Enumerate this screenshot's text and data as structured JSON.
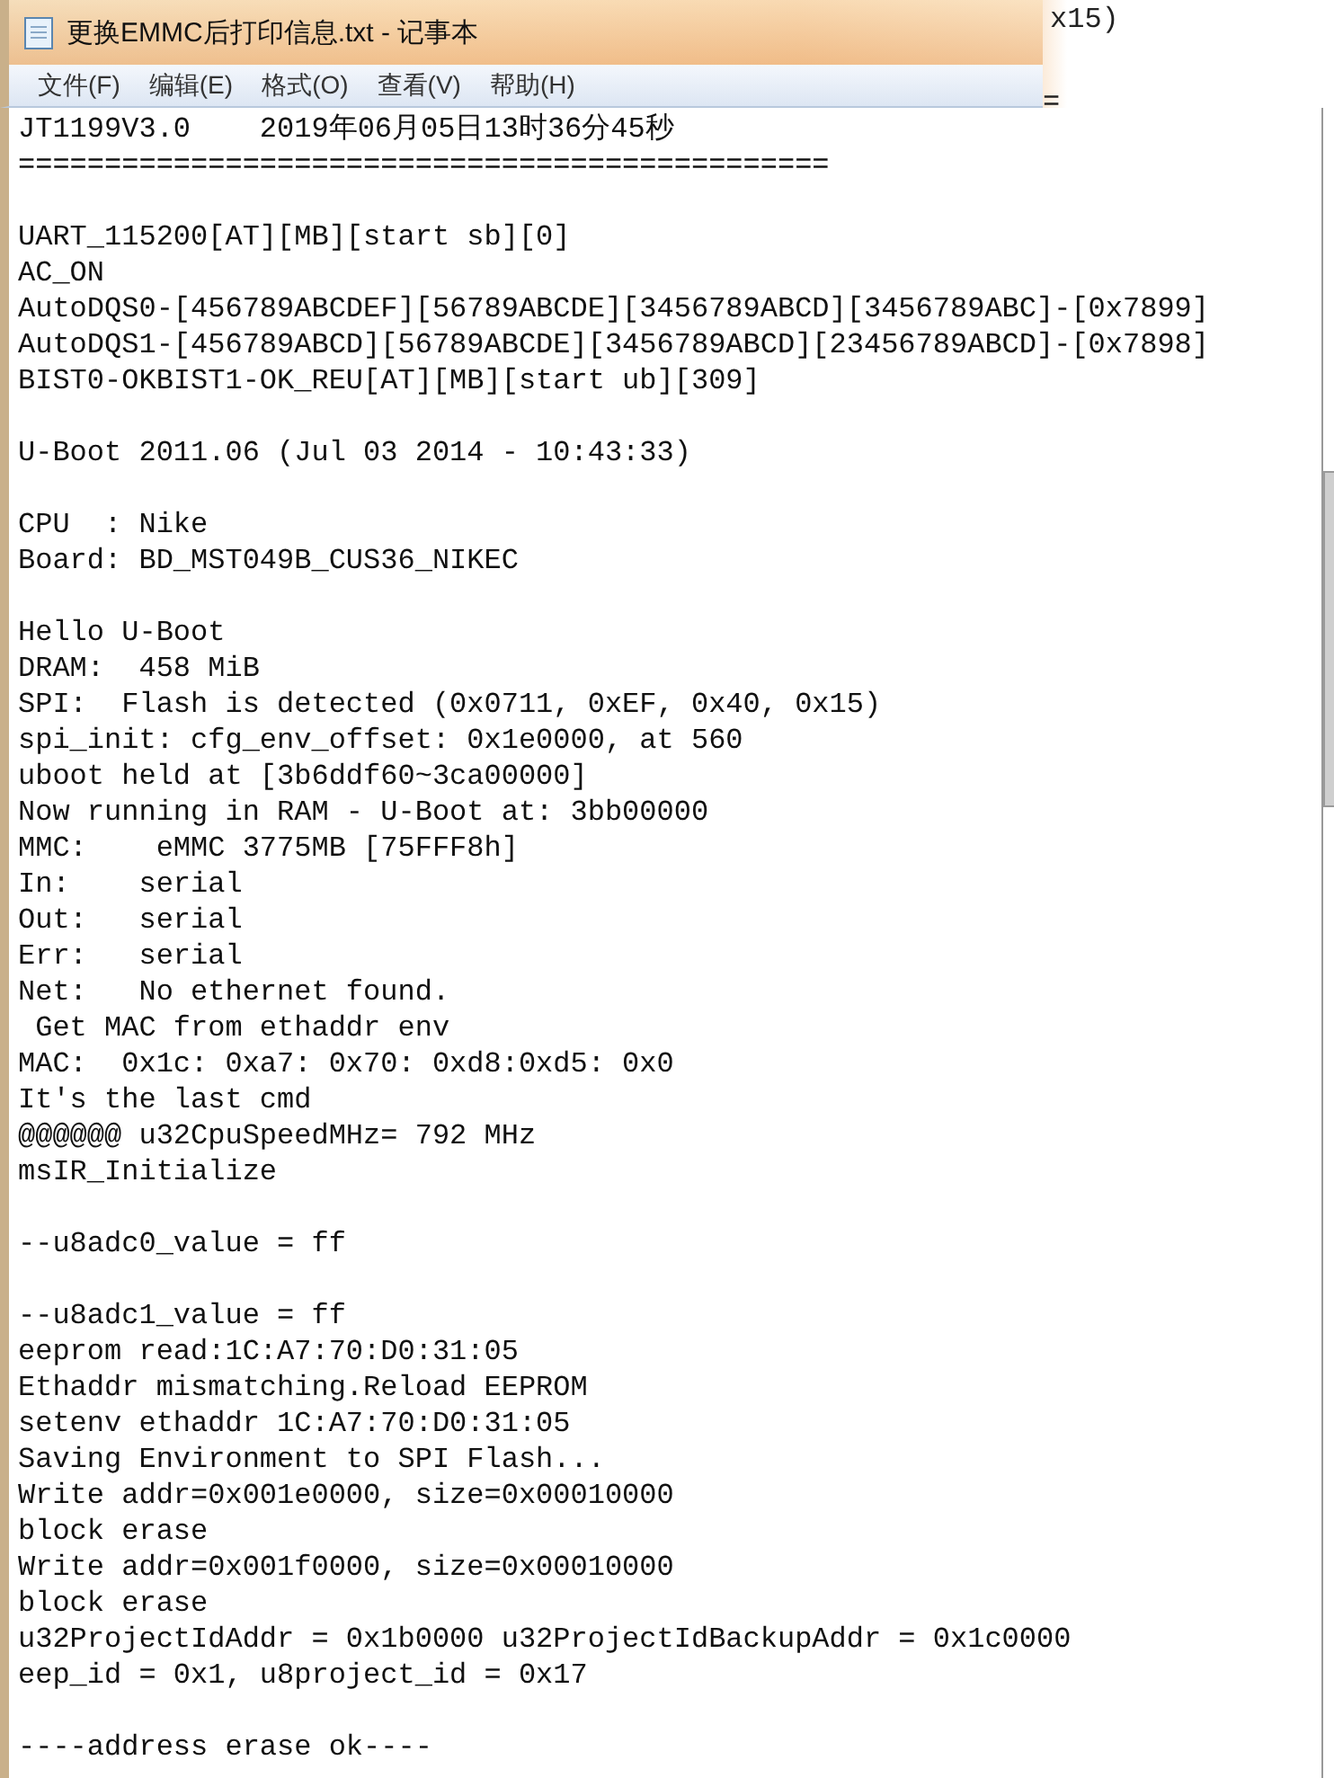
{
  "window": {
    "title": "更换EMMC后打印信息.txt - 记事本"
  },
  "background_window": {
    "fragments": [
      "x15)",
      "="
    ]
  },
  "menu": [
    "文件(F)",
    "编辑(E)",
    "格式(O)",
    "查看(V)",
    "帮助(H)"
  ],
  "blocks": [
    [
      "JT1199V3.0    2019年06月05日13时36分45秒",
      "==============================================="
    ],
    [
      "UART_115200[AT][MB][start sb][0]",
      "AC_ON",
      "AutoDQS0-[456789ABCDEF][56789ABCDE][3456789ABCD][3456789ABC]-[0x7899]",
      "AutoDQS1-[456789ABCD][56789ABCDE][3456789ABCD][23456789ABCD]-[0x7898]",
      "BIST0-OKBIST1-OK_REU[AT][MB][start ub][309]"
    ],
    [
      "U-Boot 2011.06 (Jul 03 2014 - 10:43:33)"
    ],
    [
      "CPU  : Nike",
      "Board: BD_MST049B_CUS36_NIKEC"
    ],
    [
      "Hello U-Boot",
      "DRAM:  458 MiB",
      "SPI:  Flash is detected (0x0711, 0xEF, 0x40, 0x15)",
      "spi_init: cfg_env_offset: 0x1e0000, at 560",
      "uboot held at [3b6ddf60~3ca00000]",
      "Now running in RAM - U-Boot at: 3bb00000",
      "MMC:    eMMC 3775MB [75FFF8h]",
      "In:    serial",
      "Out:   serial",
      "Err:   serial",
      "Net:   No ethernet found.",
      " Get MAC from ethaddr env",
      "MAC:  0x1c: 0xa7: 0x70: 0xd8:0xd5: 0x0",
      "It's the last cmd",
      "@@@@@@ u32CpuSpeedMHz= 792 MHz",
      "msIR_Initialize"
    ],
    [
      "--u8adc0_value = ff"
    ],
    [
      "--u8adc1_value = ff",
      "eeprom read:1C:A7:70:D0:31:05",
      "Ethaddr mismatching.Reload EEPROM",
      "setenv ethaddr 1C:A7:70:D0:31:05",
      "Saving Environment to SPI Flash...",
      "Write addr=0x001e0000, size=0x00010000",
      "block erase",
      "Write addr=0x001f0000, size=0x00010000",
      "block erase",
      "u32ProjectIdAddr = 0x1b0000 u32ProjectIdBackupAddr = 0x1c0000",
      "eep_id = 0x1, u8project_id = 0x17"
    ],
    [
      "----address erase ok----"
    ]
  ]
}
